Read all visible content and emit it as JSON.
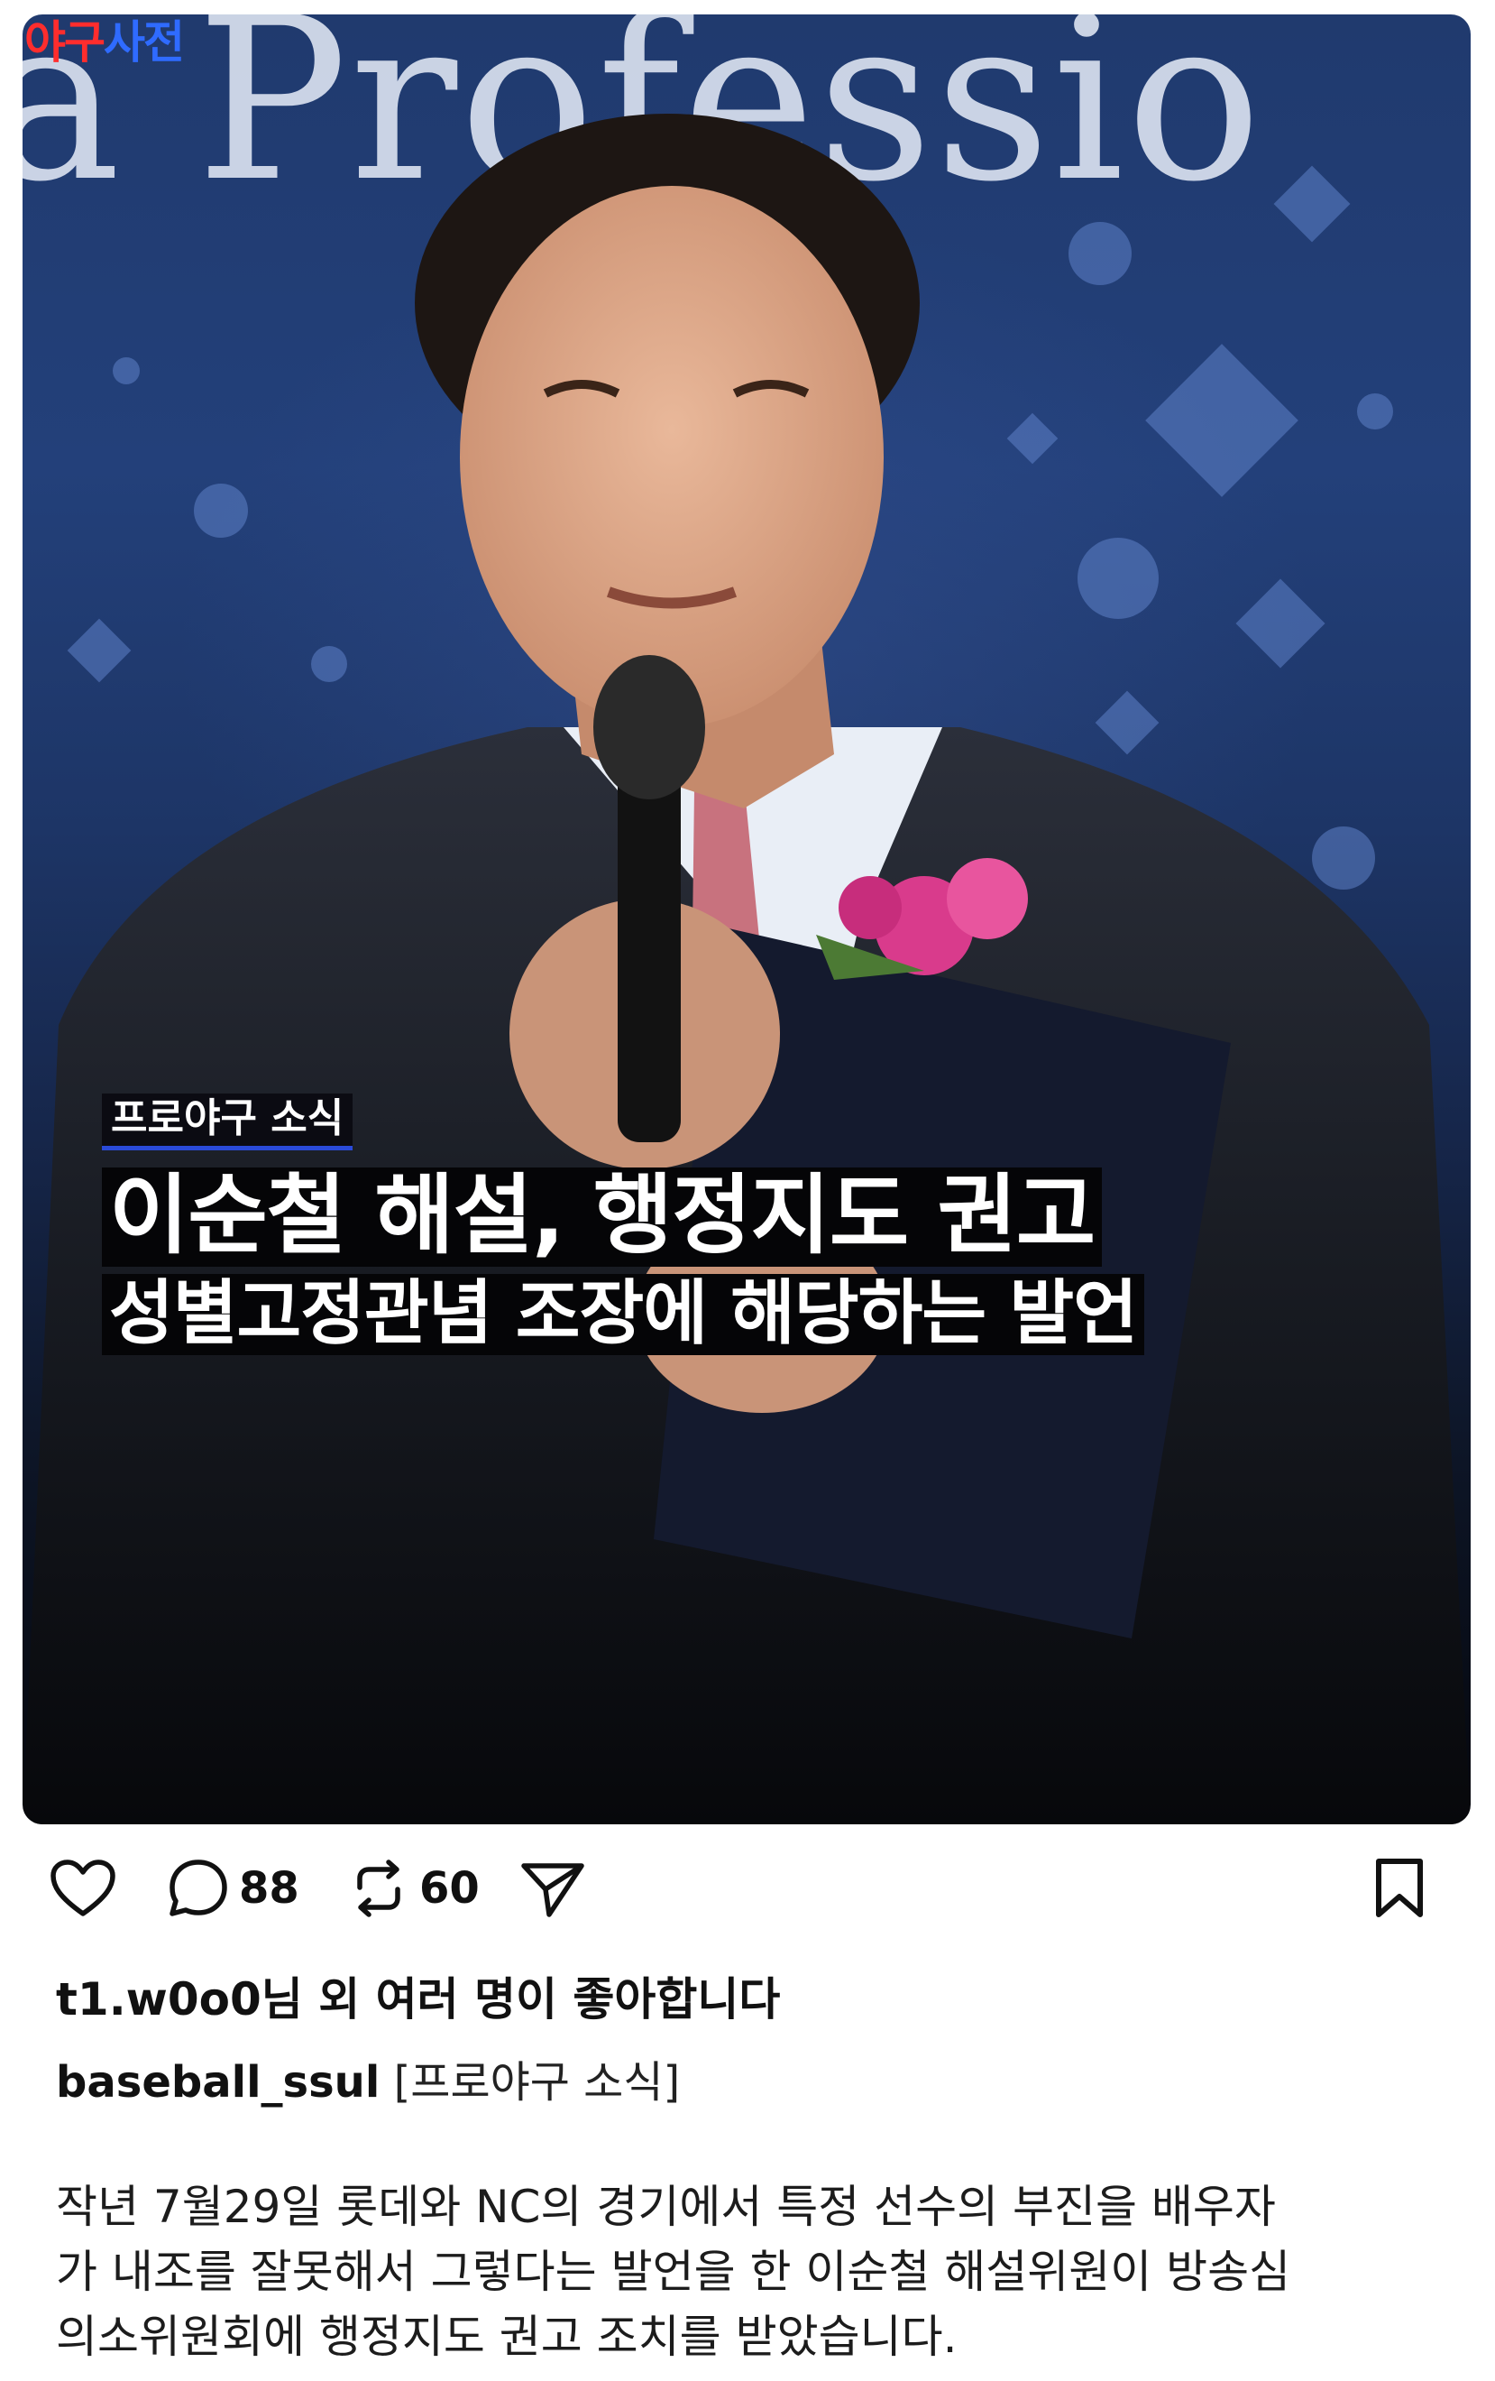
{
  "image": {
    "background_text": "a Professio",
    "brand": {
      "part1": "야구",
      "part2": "사전"
    },
    "tag": "프로야구 소식",
    "headline_line1": "이순철 해설, 행정지도 권고",
    "headline_line2": "성별고정관념 조장에 해당하는 발언"
  },
  "actions": {
    "like_icon": "heart-icon",
    "comment_icon": "comment-icon",
    "comment_count": "88",
    "repost_icon": "repost-icon",
    "repost_count": "60",
    "share_icon": "send-icon",
    "save_icon": "bookmark-icon"
  },
  "likes_text": "t1.w0o0님 외 여러 명이 좋아합니다",
  "caption": {
    "username": "baseball_ssul",
    "text": "[프로야구 소식]"
  },
  "body_lines": [
    "작년 7월29일 롯데와 NC의 경기에서 특정 선수의 부진을 배우자",
    "가 내조를 잘못해서 그렇다는 발언을 한 이순철 해설위원이 방송심",
    "의소위원회에 행정지도 권고 조치를 받았습니다."
  ]
}
